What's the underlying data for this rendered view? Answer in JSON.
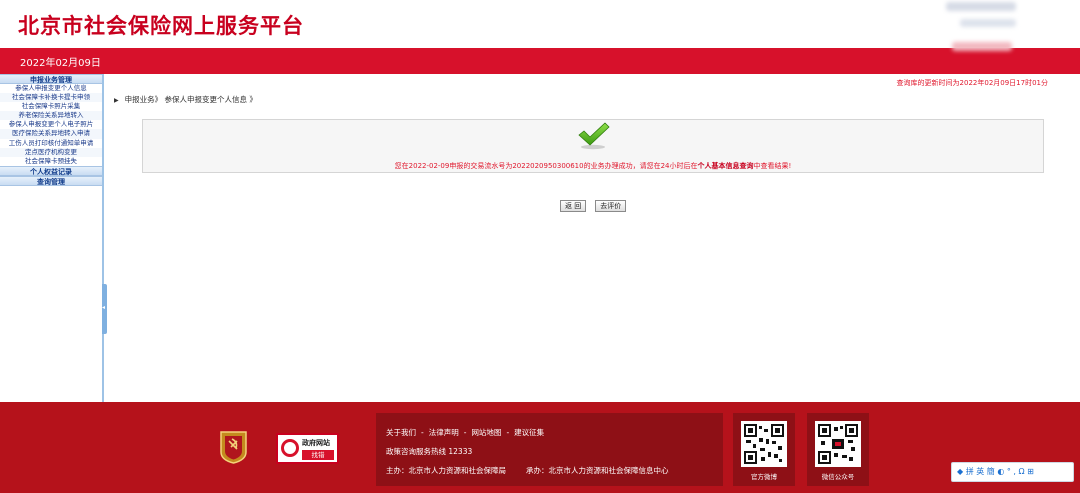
{
  "header": {
    "site_title": "北京市社会保险网上服务平台"
  },
  "topbar": {
    "date": "2022年02月09日"
  },
  "sidebar": {
    "sections": [
      {
        "title": "申报业务管理",
        "items": [
          "参保人申报变更个人信息",
          "社会保障卡补换卡提卡申领",
          "社会保障卡照片采集",
          "养老保险关系异地转入",
          "参保人申报变更个人电子照片",
          "医疗保险关系异地转入申请",
          "工伤人员打印核付通知单申请",
          "定点医疗机构变更",
          "社会保障卡预挂失"
        ]
      },
      {
        "title": "个人权益记录",
        "items": []
      },
      {
        "title": "查询管理",
        "items": []
      }
    ]
  },
  "main": {
    "breadcrumb": "申报业务》 参保人申报变更个人信息 》",
    "update_time": "查询库的更新时间为2022年02月09日17时01分",
    "result": {
      "message_prefix": "您在2022-02-09申报的交易流水号为2022020950300610的业务办理成功，请您在24小时后在",
      "message_link": "个人基本信息查询",
      "message_suffix": "中查看结果!"
    },
    "buttons": {
      "back": "返 回",
      "evaluate": "去评价"
    }
  },
  "footer": {
    "gov_badge_title": "政府网站",
    "gov_badge_button": "找错",
    "links": [
      "关于我们",
      "法律声明",
      "网站地图",
      "建议征集"
    ],
    "hotline": "政策咨询服务热线 12333",
    "sponsor": "主办：北京市人力资源和社会保障局",
    "organizer": "承办：北京市人力资源和社会保障信息中心",
    "qr_weibo_label": "官方微博",
    "qr_wechat_label": "微信公众号",
    "ime_text": "拼 英 簡 ◐ ° , Ω ⊞"
  },
  "colors": {
    "brand_red": "#d7112b",
    "footer_red": "#b5121b",
    "success_green": "#4caf1f",
    "sidebar_blue": "#123d8c"
  }
}
